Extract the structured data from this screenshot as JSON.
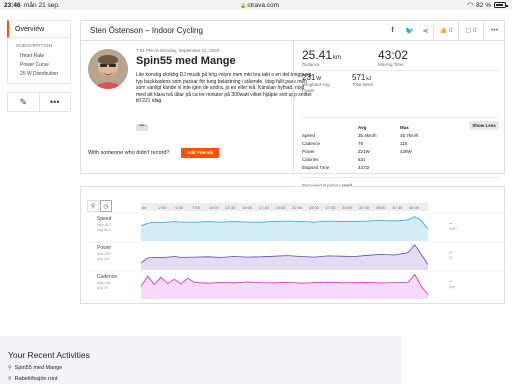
{
  "statusbar": {
    "time": "23:46",
    "date": "mån 21 sep.",
    "url": "strava.com",
    "battery": "82 %"
  },
  "nav": {
    "overview": "Overview",
    "subscription_title": "SUBSCRIPTION",
    "items": [
      "Heart Rate",
      "Power Curve",
      "25 W Distribution"
    ]
  },
  "activity": {
    "header_title": "Sten Östenson – Indoor Cycling",
    "kudos_count": "0",
    "comment_count": "0",
    "meta": "7:31 PM on Monday, September 21, 2020",
    "name": "Spin55 med Mange",
    "description": "Lite konstig skriktig DJ musik på hög volym men mkt bra takt o en del tunggung typ backkadens som passar för tung belastning i stående. Idag fullt pass men som vanligt kände vi inte igen de andra, jo en eller två. Känslan hyfsad, nöjd med att klara två låtar på ca tre minuter på 300watt vilket hjälpte sntt upp snittet till 221 idag",
    "more": "•••",
    "record_question": "With someone who didn't record?",
    "add_friends": "Add Friends"
  },
  "stats": {
    "distance": {
      "value": "25.41",
      "unit": "km",
      "label": "Distance"
    },
    "moving_time": {
      "value": "43:02",
      "label": "Moving Time"
    },
    "power": {
      "value": "231",
      "unit": "W",
      "label1": "Weighted Avg",
      "label2": "Power"
    },
    "energy": {
      "value": "571",
      "unit": "kJ",
      "label": "Total Work"
    },
    "table": {
      "headers": [
        "",
        "Avg",
        "Max"
      ],
      "rows": [
        [
          "Speed",
          "35.4km/h",
          "45.7km/h"
        ],
        [
          "Cadence",
          "79",
          "118"
        ],
        [
          "Power",
          "221W",
          "439W"
        ],
        [
          "Calories",
          "631",
          ""
        ],
        [
          "Elapsed Time",
          "43:02",
          ""
        ]
      ]
    },
    "show_less": "Show Less",
    "perceived_label": "Perceived Exertion:",
    "perceived_value": "Hard"
  },
  "chart_data": {
    "type": "line",
    "x_unit": "minutes",
    "x_ticks": [
      "0s",
      "2:30",
      "5:00",
      "7:30",
      "10:00",
      "12:30",
      "15:00",
      "17:30",
      "20:00",
      "22:30",
      "25:00",
      "27:30",
      "30:00",
      "32:30",
      "35:00",
      "37:30",
      "40:00"
    ],
    "xlim": [
      0,
      43
    ],
    "series": [
      {
        "name": "Speed",
        "stats": [
          "Max 45.7",
          "Avg 35.4"
        ],
        "right_value": "--",
        "right_unit": "km/h",
        "color": "#1fa3d6",
        "fill": "#d4eef8",
        "ylim": [
          0,
          50
        ],
        "x": [
          0,
          1,
          2,
          3,
          4,
          5,
          6,
          8,
          10,
          12,
          14,
          16,
          18,
          20,
          22,
          24,
          26,
          28,
          30,
          32,
          34,
          36,
          38,
          40,
          41,
          42,
          43
        ],
        "y": [
          28,
          33,
          35,
          34,
          35,
          36,
          35,
          35,
          36,
          35,
          36,
          35,
          35,
          36,
          37,
          36,
          35,
          37,
          36,
          36,
          37,
          38,
          37,
          39,
          45,
          38,
          22
        ]
      },
      {
        "name": "Power",
        "stats": [
          "Max 439",
          "Avg 221"
        ],
        "right_value": "--",
        "right_unit": "W",
        "color": "#6645b5",
        "fill": "#e4dcf3",
        "ylim": [
          0,
          450
        ],
        "x": [
          0,
          1,
          2,
          3,
          4,
          5,
          6,
          8,
          10,
          12,
          14,
          16,
          18,
          20,
          22,
          24,
          26,
          28,
          30,
          32,
          34,
          36,
          38,
          40,
          41,
          42,
          43
        ],
        "y": [
          120,
          200,
          210,
          205,
          215,
          225,
          210,
          215,
          220,
          210,
          225,
          215,
          220,
          230,
          240,
          225,
          215,
          235,
          230,
          225,
          245,
          260,
          250,
          290,
          420,
          260,
          90
        ]
      },
      {
        "name": "Cadence",
        "stats": [
          "Max 118",
          "Avg 79"
        ],
        "right_value": "--",
        "right_unit": "rpm",
        "color": "#d62ad6",
        "fill": "#f8d9f8",
        "ylim": [
          0,
          130
        ],
        "x": [
          0,
          1,
          2,
          3,
          4,
          5,
          6,
          7,
          8,
          9,
          10,
          12,
          14,
          16,
          18,
          20,
          22,
          24,
          26,
          28,
          30,
          32,
          34,
          36,
          38,
          40,
          41,
          42,
          43
        ],
        "y": [
          60,
          110,
          70,
          105,
          75,
          95,
          72,
          100,
          80,
          78,
          76,
          80,
          78,
          82,
          79,
          78,
          80,
          76,
          79,
          81,
          78,
          79,
          80,
          77,
          79,
          80,
          118,
          60,
          20
        ]
      }
    ]
  },
  "recent": {
    "title": "Your Recent Activities",
    "items": [
      "Spin55 med Mange",
      "Rabelöfssjön runt"
    ]
  }
}
